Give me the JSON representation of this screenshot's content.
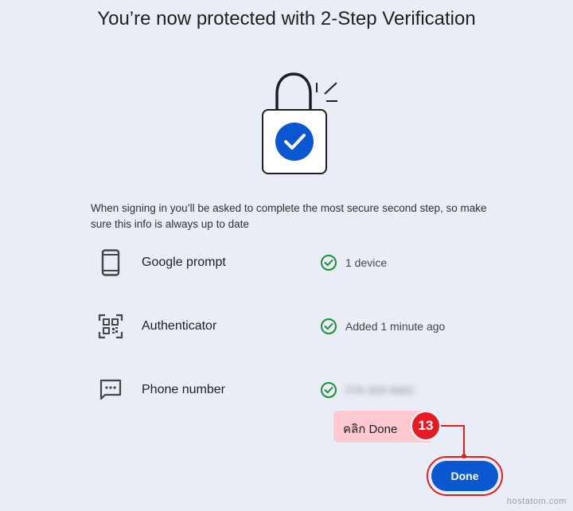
{
  "page": {
    "title": "You’re now protected with 2-Step Verification",
    "description": "When signing in you’ll be asked to complete the most secure second step, so make sure this info is always up to date"
  },
  "methods": [
    {
      "icon": "phone-icon",
      "label": "Google prompt",
      "status": "1 device",
      "status_icon": "check-circle-icon"
    },
    {
      "icon": "qr-code-icon",
      "label": "Authenticator",
      "status": "Added 1 minute ago",
      "status_icon": "check-circle-icon"
    },
    {
      "icon": "message-icon",
      "label": "Phone number",
      "status": "076-309 6462",
      "status_icon": "check-circle-icon",
      "status_blurred": true
    }
  ],
  "annotation": {
    "callout_text": "คลิก Done",
    "step_number": "13"
  },
  "actions": {
    "done_label": "Done"
  },
  "watermark": "hostatom.com",
  "colors": {
    "background": "#e9eef6",
    "primary": "#0b57d0",
    "success": "#1e8e3e",
    "annotation_red": "#e51c23",
    "callout_pink": "#fbc9cf"
  }
}
